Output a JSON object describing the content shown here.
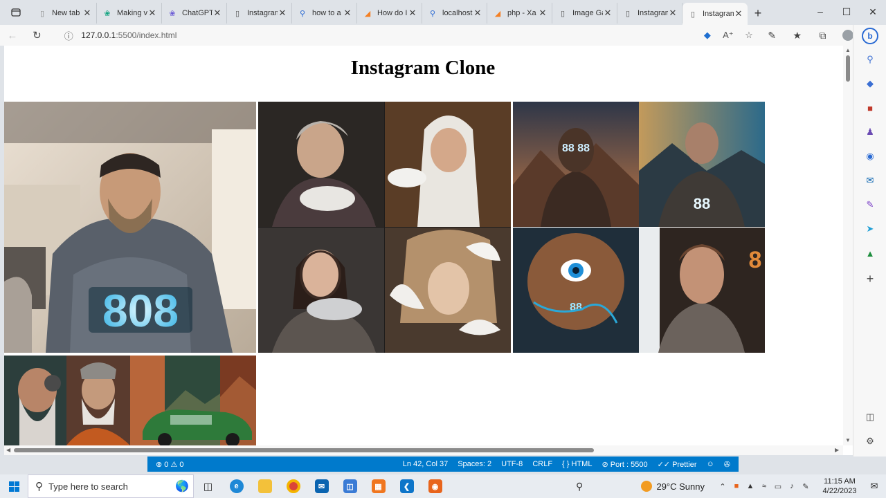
{
  "browser": {
    "tabs": [
      {
        "title": "New tab",
        "icon": "new-tab-icon",
        "color": "#888888"
      },
      {
        "title": "Making v",
        "icon": "chatgpt-icon",
        "color": "#10a37f"
      },
      {
        "title": "ChatGPT",
        "icon": "chatgpt-icon",
        "color": "#6b5bd6"
      },
      {
        "title": "Instagram",
        "icon": "page-icon",
        "color": "#555555"
      },
      {
        "title": "how to a",
        "icon": "search-icon",
        "color": "#2a6ad3"
      },
      {
        "title": "How do I",
        "icon": "stackoverflow-icon",
        "color": "#f48024"
      },
      {
        "title": "localhost",
        "icon": "search-icon",
        "color": "#2a6ad3"
      },
      {
        "title": "php - Xa",
        "icon": "stackoverflow-icon",
        "color": "#f48024"
      },
      {
        "title": "Image Ga",
        "icon": "page-icon",
        "color": "#555555"
      },
      {
        "title": "Instagram",
        "icon": "page-icon",
        "color": "#555555"
      },
      {
        "title": "Instagram",
        "icon": "page-icon",
        "color": "#555555",
        "active": true
      }
    ],
    "address": {
      "host": "127.0.0.1",
      "path": ":5500/index.html"
    }
  },
  "page": {
    "title": "Instagram Clone",
    "photos": [
      {
        "alt": "portrait-808-hoodie",
        "colors": [
          "#e8dccb",
          "#8f8578",
          "#3d3b3a"
        ]
      },
      {
        "alt": "women-with-doves-collage",
        "colors": [
          "#2a2a2a",
          "#6b5a4a",
          "#c9b8a4"
        ]
      },
      {
        "alt": "mountain-88-figures-collage",
        "colors": [
          "#c97b4b",
          "#2d3644",
          "#5a8fb3"
        ]
      },
      {
        "alt": "old-warrior-car-collage",
        "colors": [
          "#3a4a3a",
          "#b45a2a",
          "#1e6a3a"
        ]
      }
    ]
  },
  "vscode_status": {
    "errors": "0",
    "warnings": "0",
    "position": "Ln 42, Col 37",
    "spaces": "Spaces: 2",
    "encoding": "UTF-8",
    "eol": "CRLF",
    "language": "HTML",
    "port": "Port : 5500",
    "prettier": "Prettier"
  },
  "taskbar": {
    "search_placeholder": "Type here to search",
    "weather": "29°C  Sunny",
    "time": "11:15 AM",
    "date": "4/22/2023"
  }
}
